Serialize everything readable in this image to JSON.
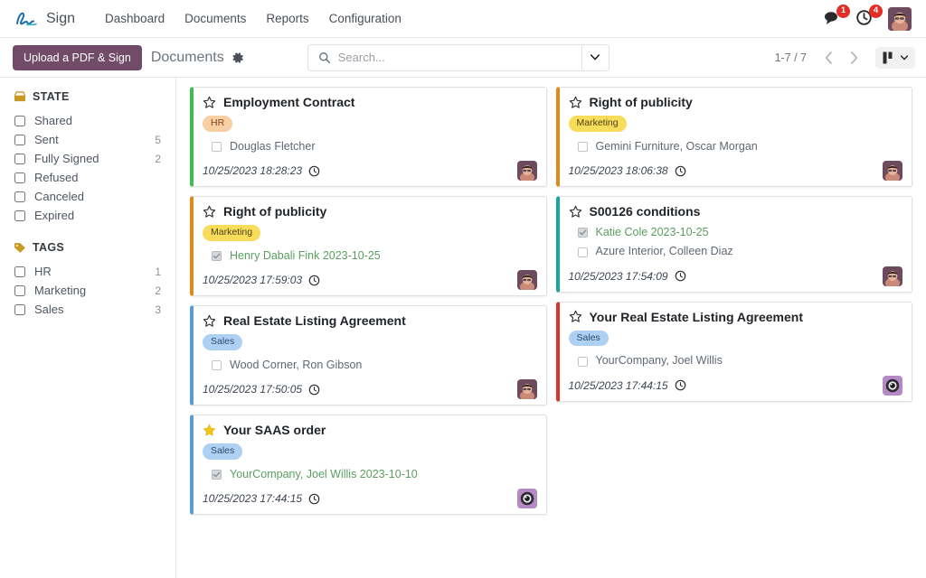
{
  "navbar": {
    "brand_icon": "signature-pen-icon",
    "brand": "Sign",
    "menu": [
      {
        "label": "Dashboard"
      },
      {
        "label": "Documents"
      },
      {
        "label": "Reports"
      },
      {
        "label": "Configuration"
      }
    ],
    "messages_icon": "speech-bubble-icon",
    "messages_count": "1",
    "activities_icon": "clock-activity-icon",
    "activities_count": "4",
    "avatar_icon": "user-avatar"
  },
  "control_panel": {
    "upload_button": "Upload a PDF & Sign",
    "breadcrumb": "Documents",
    "gear_icon": "gear-icon",
    "search": {
      "icon": "search-icon",
      "value": "",
      "placeholder": "Search...",
      "toggle_icon": "chevron-down-icon"
    },
    "pager": "1-7 / 7",
    "prev_icon": "chevron-left-icon",
    "next_icon": "chevron-right-icon",
    "view_switcher_icon": "kanban-view-icon",
    "view_switcher_caret": "chevron-down-icon"
  },
  "sidebar": {
    "sections": [
      {
        "icon": "inbox-icon",
        "title": "STATE",
        "items": [
          {
            "label": "Shared",
            "count": "",
            "checked": false
          },
          {
            "label": "Sent",
            "count": "5",
            "checked": false
          },
          {
            "label": "Fully Signed",
            "count": "2",
            "checked": false
          },
          {
            "label": "Refused",
            "count": "",
            "checked": false
          },
          {
            "label": "Canceled",
            "count": "",
            "checked": false
          },
          {
            "label": "Expired",
            "count": "",
            "checked": false
          }
        ]
      },
      {
        "icon": "tag-icon",
        "title": "TAGS",
        "items": [
          {
            "label": "HR",
            "count": "1",
            "checked": false
          },
          {
            "label": "Marketing",
            "count": "2",
            "checked": false
          },
          {
            "label": "Sales",
            "count": "3",
            "checked": false
          }
        ]
      }
    ]
  },
  "colors": {
    "brand_purple": "#714b67",
    "badge_red": "#e32d28",
    "border_green": "#3fbd52",
    "border_orange": "#e08a1e",
    "border_blue": "#5b9bd5",
    "border_teal": "#1aa6a0",
    "border_red": "#d9352c",
    "signed_green": "#5a9e5f"
  },
  "kanban": {
    "columns": [
      {
        "cards": [
          {
            "title": "Employment Contract",
            "starred": false,
            "star_icon": "star-outline-icon",
            "tag": "HR",
            "tag_class": "tag-hr",
            "accent": "#3fbd52",
            "signers": [
              {
                "name": "Douglas Fletcher",
                "signed": false
              }
            ],
            "date": "10/25/2023 18:28:23",
            "clock_icon": "clock-icon",
            "avatar_icon": "user-avatar-dark"
          },
          {
            "title": "Right of publicity",
            "starred": false,
            "star_icon": "star-outline-icon",
            "tag": "Marketing",
            "tag_class": "tag-marketing",
            "accent": "#e08a1e",
            "signers": [
              {
                "name": "Henry Dabali Fink 2023-10-25",
                "signed": true
              }
            ],
            "date": "10/25/2023 17:59:03",
            "clock_icon": "clock-icon",
            "avatar_icon": "user-avatar-dark"
          },
          {
            "title": "Real Estate Listing Agreement",
            "starred": false,
            "star_icon": "star-outline-icon",
            "tag": "Sales",
            "tag_class": "tag-sales",
            "accent": "#5b9bd5",
            "signers": [
              {
                "name": "Wood Corner, Ron Gibson",
                "signed": false
              }
            ],
            "date": "10/25/2023 17:50:05",
            "clock_icon": "clock-icon",
            "avatar_icon": "user-avatar-dark"
          },
          {
            "title": "Your SAAS order",
            "starred": true,
            "star_icon": "star-filled-icon",
            "tag": "Sales",
            "tag_class": "tag-sales",
            "accent": "#5b9bd5",
            "signers": [
              {
                "name": "YourCompany, Joel Willis 2023-10-10",
                "signed": true
              }
            ],
            "date": "10/25/2023 17:44:15",
            "clock_icon": "clock-icon",
            "avatar_icon": "user-avatar-purple"
          }
        ]
      },
      {
        "cards": [
          {
            "title": "Right of publicity",
            "starred": false,
            "star_icon": "star-outline-icon",
            "tag": "Marketing",
            "tag_class": "tag-marketing",
            "accent": "#e08a1e",
            "signers": [
              {
                "name": "Gemini Furniture, Oscar Morgan",
                "signed": false
              }
            ],
            "date": "10/25/2023 18:06:38",
            "clock_icon": "clock-icon",
            "avatar_icon": "user-avatar-dark"
          },
          {
            "title": "S00126 conditions",
            "starred": false,
            "star_icon": "star-outline-icon",
            "tag": "",
            "tag_class": "",
            "accent": "#1aa6a0",
            "signers": [
              {
                "name": "Katie Cole 2023-10-25",
                "signed": true
              },
              {
                "name": "Azure Interior, Colleen Diaz",
                "signed": false
              }
            ],
            "date": "10/25/2023 17:54:09",
            "clock_icon": "clock-icon",
            "avatar_icon": "user-avatar-dark"
          },
          {
            "title": "Your Real Estate Listing Agreement",
            "starred": false,
            "star_icon": "star-outline-icon",
            "tag": "Sales",
            "tag_class": "tag-sales",
            "accent": "#d9352c",
            "signers": [
              {
                "name": "YourCompany, Joel Willis",
                "signed": false
              }
            ],
            "date": "10/25/2023 17:44:15",
            "clock_icon": "clock-icon",
            "avatar_icon": "user-avatar-purple"
          }
        ]
      }
    ]
  }
}
